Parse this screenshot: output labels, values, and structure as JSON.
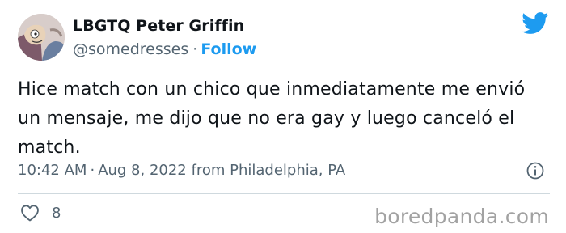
{
  "tweet": {
    "author": {
      "display_name": "LBGTQ Peter Griffin",
      "handle": "@somedresses",
      "separator": "·",
      "follow_label": "Follow"
    },
    "text": "Hice match con un chico que inmediatamente me envió un mensaje, me dijo que no era gay y luego canceló el match.",
    "time": "10:42 AM",
    "separator": "·",
    "date": "Aug 8, 2022",
    "location": "from Philadelphia, PA",
    "like_count": "8",
    "icons": {
      "brand": "twitter-bird-icon",
      "info": "info-icon",
      "like": "heart-icon"
    }
  },
  "watermark": "boredpanda.com",
  "colors": {
    "accent": "#1d9bf0",
    "secondary_text": "#536471",
    "divider": "#cfd9de",
    "watermark": "#a2a2a2"
  }
}
